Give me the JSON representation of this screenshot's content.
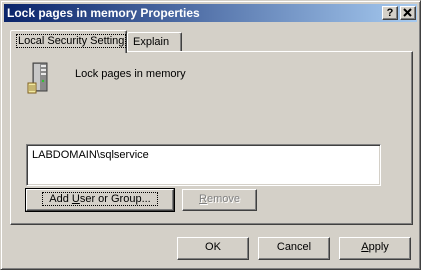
{
  "window": {
    "title": "Lock pages in memory Properties",
    "help_label": "?",
    "close_label": "✕"
  },
  "tabs": [
    {
      "label": "Local Security Setting",
      "active": true
    },
    {
      "label": "Explain",
      "active": false
    }
  ],
  "policy": {
    "name": "Lock pages in memory",
    "icon": "server-icon"
  },
  "accounts": {
    "items": [
      "LABDOMAIN\\sqlservice"
    ]
  },
  "buttons": {
    "add_prefix": "Add ",
    "add_mnemonic": "U",
    "add_suffix": "ser or Group...",
    "remove_mnemonic": "R",
    "remove_suffix": "emove",
    "ok": "OK",
    "cancel": "Cancel",
    "apply_mnemonic": "A",
    "apply_suffix": "pply"
  },
  "colors": {
    "title_gradient_start": "#0a246a",
    "title_gradient_end": "#a6caf0",
    "face": "#d4d0c8"
  }
}
